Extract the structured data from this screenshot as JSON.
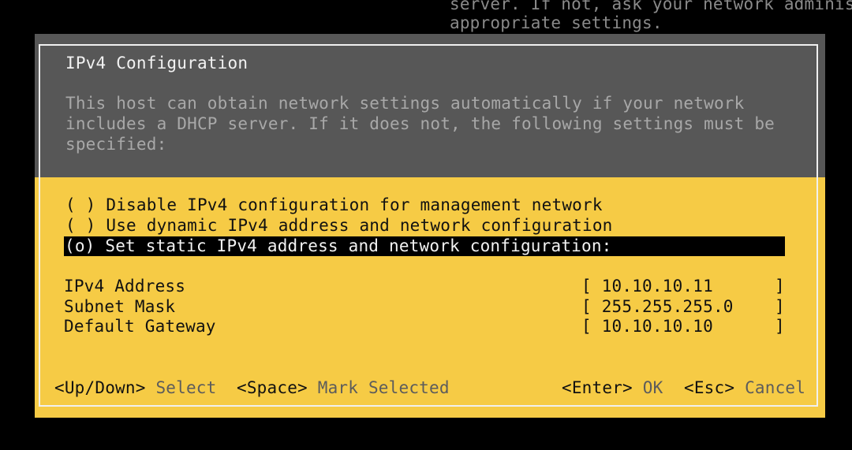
{
  "background_text": [
    "server. If not, ask your network adminis",
    "appropriate settings."
  ],
  "dialog": {
    "title": "IPv4 Configuration",
    "description": [
      "This host can obtain network settings automatically if your network",
      "includes a DHCP server. If it does not, the following settings must be",
      "specified:"
    ],
    "options": [
      {
        "marker": "( )",
        "label": "Disable IPv4 configuration for management network",
        "selected": false
      },
      {
        "marker": "( )",
        "label": "Use dynamic IPv4 address and network configuration",
        "selected": false
      },
      {
        "marker": "(o)",
        "label": "Set static IPv4 address and network configuration:",
        "selected": true
      }
    ],
    "fields": [
      {
        "label": "IPv4 Address",
        "value": "10.10.10.11"
      },
      {
        "label": "Subnet Mask",
        "value": "255.255.255.0"
      },
      {
        "label": "Default Gateway",
        "value": "10.10.10.10"
      }
    ],
    "footer": {
      "updown_key": "<Up/Down>",
      "updown_action": "Select",
      "space_key": "<Space>",
      "space_action": "Mark Selected",
      "enter_key": "<Enter>",
      "enter_action": "OK",
      "esc_key": "<Esc>",
      "esc_action": "Cancel"
    }
  },
  "colors": {
    "panel_yellow": "#f6cb45",
    "header_gray": "#575757",
    "selection": "#000000"
  }
}
